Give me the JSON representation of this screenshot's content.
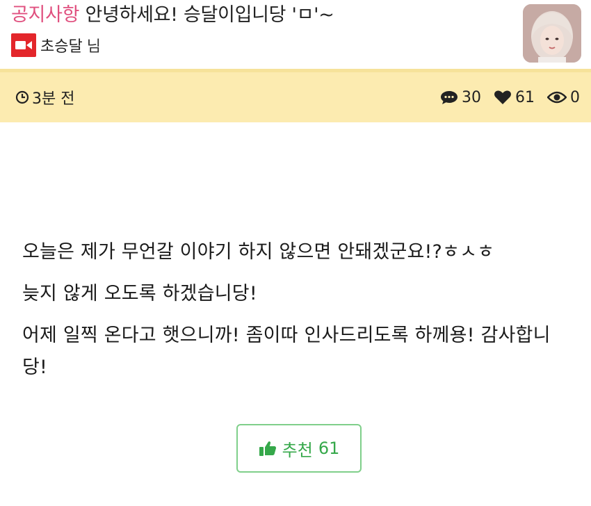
{
  "post": {
    "category": "공지사항",
    "title": "안녕하세요! 승달이입니당 'ㅁ'~",
    "author": "초승달",
    "author_suffix": "님",
    "time": "3분 전",
    "comments": "30",
    "likes": "61",
    "views": "0"
  },
  "content": {
    "paragraphs": [
      "오늘은 제가 무언갈 이야기 하지 않으면 안돼겠군요!?ㅎㅅㅎ",
      "늦지 않게 오도록 하겠습니당!",
      "어제 일찍 온다고 햇으니까! 좀이따 인사드리도록 하께용! 감사합니당!"
    ]
  },
  "recommend": {
    "label": "추천",
    "count": "61"
  },
  "icons": {
    "broadcast": "video-camera-icon",
    "time": "clock-icon",
    "comments": "comment-icon",
    "likes": "heart-icon",
    "views": "eye-icon",
    "recommend": "thumbs-up-icon"
  },
  "colors": {
    "category": "#e0507f",
    "meta_bar": "#fcebb0",
    "header_border": "#f6e29a",
    "broadcast_icon": "#e3262b",
    "recommend": "#35a84a",
    "recommend_border": "#7fcf8a"
  }
}
